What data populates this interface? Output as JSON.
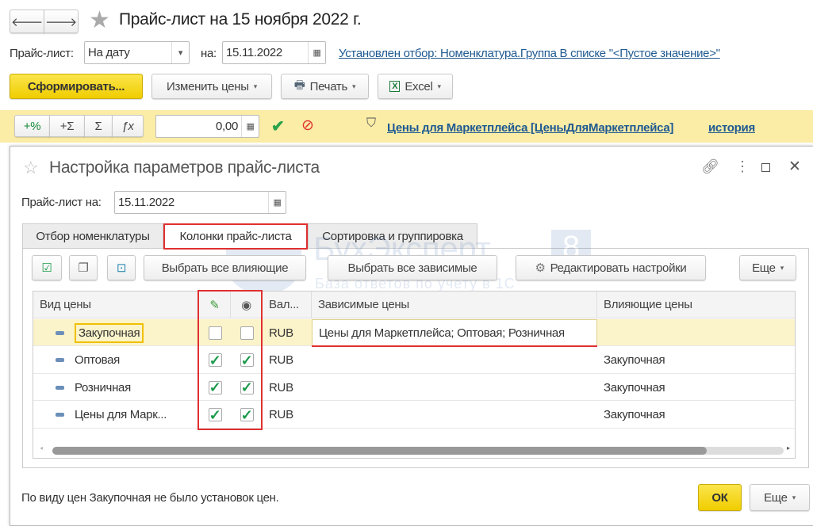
{
  "window": {
    "title": "Прайс-лист на 15 ноября 2022 г."
  },
  "filters": {
    "pricelist_label": "Прайс-лист:",
    "pricelist_value": "На дату",
    "date_label": "на:",
    "date_value": "15.11.2022",
    "filter_link": "Установлен отбор: Номенклатура.Группа В списке \"<Пустое значение>\""
  },
  "toolbar": {
    "generate": "Сформировать...",
    "change_prices": "Изменить цены",
    "print": "Печать",
    "excel": "Excel"
  },
  "edit_bar": {
    "plus_percent": "+%",
    "plus_sum": "+Σ",
    "sum": "Σ",
    "fx": "ƒx",
    "value": "0,00",
    "price_link": "Цены для Маркетплейса [ЦеныДляМаркетплейса]",
    "history_link": "история"
  },
  "dialog": {
    "title": "Настройка параметров прайс-листа",
    "date_label": "Прайс-лист на:",
    "date_value": "15.11.2022",
    "tabs": [
      {
        "label": "Отбор номенклатуры"
      },
      {
        "label": "Колонки прайс-листа",
        "active": true
      },
      {
        "label": "Сортировка и группировка"
      }
    ],
    "buttons": {
      "select_influencing": "Выбрать все влияющие",
      "select_dependent": "Выбрать все зависимые",
      "edit_settings": "Редактировать настройки",
      "more": "Еще"
    },
    "columns": {
      "price_type": "Вид цены",
      "currency": "Вал...",
      "dependent": "Зависимые цены",
      "influencing": "Влияющие цены"
    },
    "rows": [
      {
        "name": "Закупочная",
        "edit": false,
        "visible": false,
        "currency": "RUB",
        "dependent": "Цены для Маркетплейса; Оптовая; Розничная",
        "influencing": ""
      },
      {
        "name": "Оптовая",
        "edit": true,
        "visible": true,
        "currency": "RUB",
        "dependent": "",
        "influencing": "Закупочная"
      },
      {
        "name": "Розничная",
        "edit": true,
        "visible": true,
        "currency": "RUB",
        "dependent": "",
        "influencing": "Закупочная"
      },
      {
        "name": "Цены для Марк...",
        "edit": true,
        "visible": true,
        "currency": "RUB",
        "dependent": "",
        "influencing": "Закупочная"
      }
    ],
    "status": "По виду цен Закупочная не было установок цен.",
    "ok": "ОК",
    "more": "Еще"
  },
  "watermark": {
    "brand": "БухЭксперт",
    "number": "8",
    "tagline": "База ответов по учету в 1С"
  },
  "colors": {
    "accent_yellow": "#f5d400",
    "highlight_row": "#fbf3c9",
    "annotation_red": "#e03030",
    "link": "#1f5a91",
    "check_green": "#1a9a4a"
  }
}
